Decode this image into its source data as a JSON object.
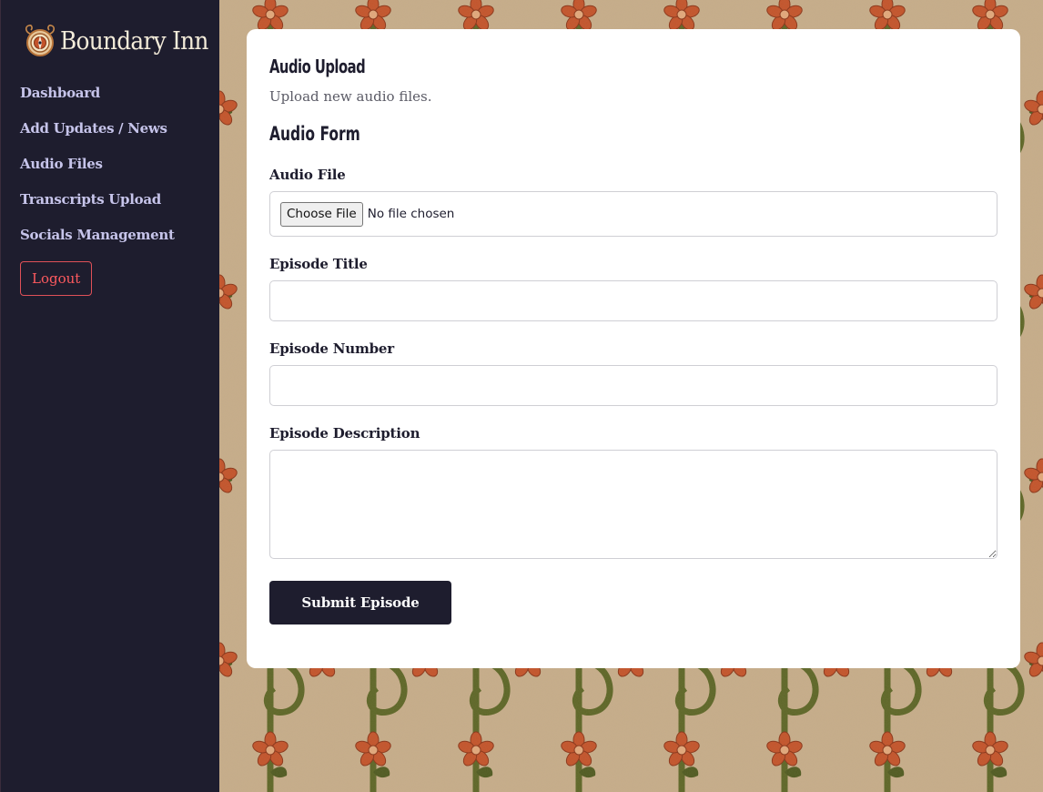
{
  "sidebar": {
    "brand": "Boundary Inn",
    "nav": [
      {
        "label": "Dashboard"
      },
      {
        "label": "Add Updates / News"
      },
      {
        "label": "Audio Files"
      },
      {
        "label": "Transcripts Upload"
      },
      {
        "label": "Socials Management"
      }
    ],
    "logout_label": "Logout"
  },
  "main": {
    "title": "Audio Upload",
    "subtitle": "Upload new audio files.",
    "section_title": "Audio Form",
    "form": {
      "audio_file_label": "Audio File",
      "choose_file_label": "Choose File",
      "no_file_text": "No file chosen",
      "episode_title_label": "Episode Title",
      "episode_title_value": "",
      "episode_number_label": "Episode Number",
      "episode_number_value": "",
      "episode_description_label": "Episode Description",
      "episode_description_value": "",
      "submit_label": "Submit Episode"
    }
  },
  "colors": {
    "sidebar_bg": "#1e1d2e",
    "nav_text": "#c6c4ea",
    "logout_red": "#ff5a5f",
    "primary_button": "#1e1d2e",
    "pattern_bg": "#c7ae8b",
    "vine_green": "#5c6626",
    "flower_orange": "#c4532a"
  },
  "icons": {
    "brand_logo": "compass-emblem-icon"
  }
}
